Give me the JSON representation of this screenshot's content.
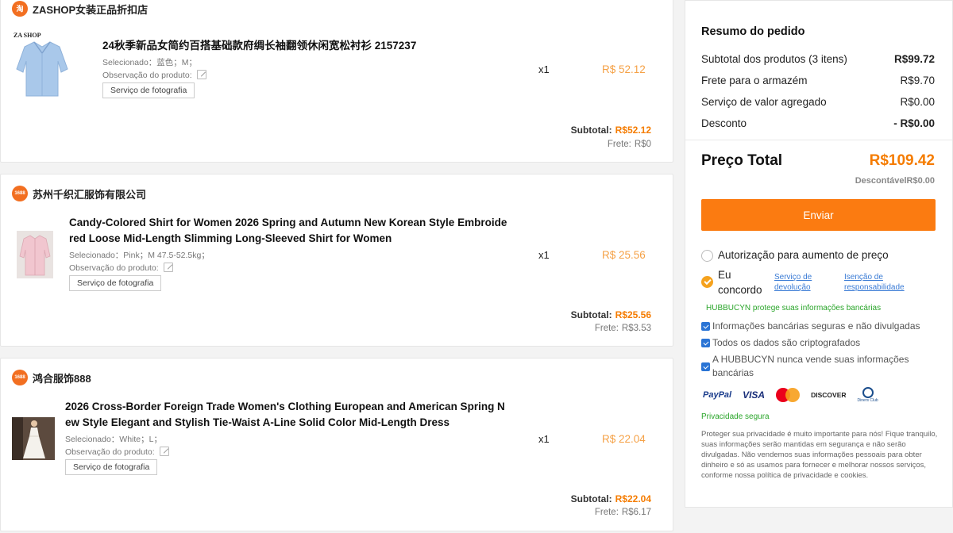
{
  "stores": [
    {
      "name": "ZASHOP女装正品折扣店",
      "icon_text": "淘",
      "brand_text": "ZA SHOP",
      "product": {
        "title": "24秋季新品女简约百搭基础款府绸长袖翻领休闲宽松衬衫 2157237",
        "selected": "Selecionado：蓝色；M；",
        "note_label": "Observação do produto:",
        "photo_service": "Serviço de fotografia",
        "qty": "x1",
        "price": "R$ 52.12"
      },
      "subtotal_label": "Subtotal:",
      "subtotal_value": "R$52.12",
      "frete_label": "Frete:",
      "frete_value": "R$0"
    },
    {
      "name": "苏州千织汇服饰有限公司",
      "icon_text": "1688",
      "product": {
        "title_line1": "Candy-Colored Shirt for Women 2026 Spring and Autumn New Korean Style Embroide",
        "title_line2": "red Loose Mid-Length Slimming Long-Sleeved Shirt for Women",
        "selected": "Selecionado：Pink；M 47.5-52.5kg；",
        "note_label": "Observação do produto:",
        "photo_service": "Serviço de fotografia",
        "qty": "x1",
        "price": "R$ 25.56"
      },
      "subtotal_label": "Subtotal:",
      "subtotal_value": "R$25.56",
      "frete_label": "Frete:",
      "frete_value": "R$3.53"
    },
    {
      "name": "鸿合服饰888",
      "icon_text": "1688",
      "product": {
        "title_line1": "2026 Cross-Border Foreign Trade Women's Clothing European and American Spring N",
        "title_line2": "ew Style Elegant and Stylish Tie-Waist A-Line Solid Color Mid-Length Dress",
        "selected": "Selecionado：White；L；",
        "note_label": "Observação do produto:",
        "photo_service": "Serviço de fotografia",
        "qty": "x1",
        "price": "R$ 22.04"
      },
      "subtotal_label": "Subtotal:",
      "subtotal_value": "R$22.04",
      "frete_label": "Frete:",
      "frete_value": "R$6.17"
    }
  ],
  "summary": {
    "title": "Resumo do pedido",
    "rows": [
      {
        "label": "Subtotal dos produtos (3 itens)",
        "value": "R$99.72"
      },
      {
        "label": "Frete para o armazém",
        "value": "R$9.70"
      },
      {
        "label": "Serviço de valor agregado",
        "value": "R$0.00"
      },
      {
        "label": "Desconto",
        "value": "- R$0.00"
      }
    ],
    "total_label": "Preço Total",
    "total_value": "R$109.42",
    "discount_line": "DescontávelR$0.00",
    "send_button": "Enviar",
    "price_increase_auth": "Autorização para aumento de preço",
    "agree_label_1": "Eu",
    "agree_label_2": "concordo",
    "return_link_1": "Serviço de",
    "return_link_2": "devolução",
    "disclaimer_link_1": "Isenção de",
    "disclaimer_link_2": "responsabilidade",
    "protect_text": "HUBBUCYN protege suas informações bancárias",
    "checks": [
      "Informações bancárias seguras e não divulgadas",
      "Todos os dados são criptografados",
      "A HUBBUCYN nunca vende suas informações bancárias"
    ],
    "payment_logos": [
      "PayPal",
      "VISA",
      "mastercard-icon",
      "DISCOVER",
      "Diners Club"
    ],
    "privacy_title": "Privacidade segura",
    "privacy_text": "Proteger sua privacidade é muito importante para nós! Fique tranquilo, suas informações serão mantidas em segurança e não serão divulgadas. Não vendemos suas informações pessoais para obter dinheiro e só as usamos para fornecer e melhorar nossos serviços, conforme nossa política de privacidade e cookies."
  },
  "colors": {
    "accent": "#fb7b11",
    "price": "#f5a146",
    "total": "#f57c00",
    "link": "#3a7bd5",
    "secure": "#2aa52a"
  }
}
